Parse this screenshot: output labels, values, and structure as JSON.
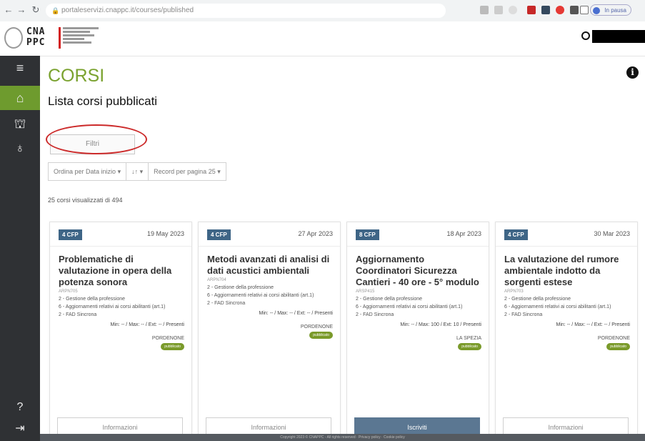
{
  "browser": {
    "url": "portaleservizi.cnappc.it/courses/published",
    "profile_label": "In pausa"
  },
  "header": {
    "logo_top": "CNA",
    "logo_bottom": "PPC"
  },
  "sidebar": {
    "items": [
      "menu-icon",
      "home-icon",
      "institution-icon",
      "award-icon",
      "help-icon",
      "logout-icon"
    ],
    "active_color": "#6e9b2e"
  },
  "page": {
    "title": "CORSI",
    "subtitle": "Lista corsi pubblicati",
    "filter_button": "Filtri",
    "sort_label": "Ordina per Data inizio",
    "sort_order": "↓↑",
    "records_label": "Record per pagina 25",
    "count_text": "25 corsi visualizzati di 494"
  },
  "courses": [
    {
      "cfp": "4 CFP",
      "date": "19 May 2023",
      "title": "Problematiche di valutazione in opera della potenza sonora",
      "code": "ARPN705",
      "lines": [
        "2 - Gestione della professione",
        "6 - Aggiornamenti relativi ai corsi abilitanti (art.1)",
        "2 - FAD Sincrona"
      ],
      "stats": "Min: -- / Max: -- / Ext: -- / Presenti",
      "city": "PORDENONE",
      "status": "pubblicato",
      "button": "Informazioni"
    },
    {
      "cfp": "4 CFP",
      "date": "27 Apr 2023",
      "title": "Metodi avanzati di analisi di dati acustici ambientali",
      "code": "ARPN704",
      "lines": [
        "2 - Gestione della professione",
        "6 - Aggiornamenti relativi ai corsi abilitanti (art.1)",
        "2 - FAD Sincrona"
      ],
      "stats": "Min: -- / Max: -- / Ext: -- / Presenti",
      "city": "PORDENONE",
      "status": "pubblicato",
      "button": "Informazioni"
    },
    {
      "cfp": "8 CFP",
      "date": "18 Apr 2023",
      "title": "Aggiornamento Coordinatori Sicurezza Cantieri - 40 ore - 5° modulo",
      "code": "ARSP415",
      "lines": [
        "2 - Gestione della professione",
        "6 - Aggiornamenti relativi ai corsi abilitanti (art.1)",
        "2 - FAD Sincrona"
      ],
      "stats": "Min: -- / Max: 100 / Ext: 10 / Presenti",
      "city": "LA SPEZIA",
      "status": "pubblicato",
      "button": "Iscriviti"
    },
    {
      "cfp": "4 CFP",
      "date": "30 Mar 2023",
      "title": "La valutazione del rumore ambientale indotto da sorgenti estese",
      "code": "ARPN703",
      "lines": [
        "2 - Gestione della professione",
        "6 - Aggiornamenti relativi ai corsi abilitanti (art.1)",
        "2 - FAD Sincrona"
      ],
      "stats": "Min: -- / Max: -- / Ext: -- / Presenti",
      "city": "PORDENONE",
      "status": "pubblicato",
      "button": "Informazioni"
    }
  ],
  "footer": {
    "text": "Copyright 2023 © CNAPPC - All rights reserved · Privacy policy · Cookie policy"
  }
}
